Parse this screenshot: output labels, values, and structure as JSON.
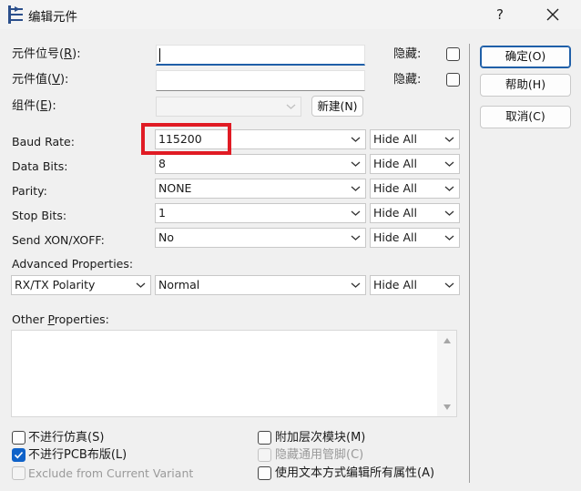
{
  "window": {
    "title": "编辑元件",
    "help_glyph": "?"
  },
  "fields": {
    "refdes": {
      "label": "元件位号(",
      "key": "R",
      "suffix": "):",
      "value": "",
      "hidden_label": "隐藏:"
    },
    "value": {
      "label": "元件值(",
      "key": "V",
      "suffix": "):",
      "value": "",
      "hidden_label": "隐藏:"
    },
    "group": {
      "label": "组件(",
      "key": "E",
      "suffix": "):",
      "value": "",
      "new_button": "新建(N)"
    }
  },
  "properties": [
    {
      "label": "Baud Rate:",
      "value": "115200",
      "visibility": "Hide All",
      "editable": true
    },
    {
      "label": "Data Bits:",
      "value": "8",
      "visibility": "Hide All"
    },
    {
      "label": "Parity:",
      "value": "NONE",
      "visibility": "Hide All"
    },
    {
      "label": "Stop Bits:",
      "value": "1",
      "visibility": "Hide All"
    },
    {
      "label": "Send XON/XOFF:",
      "value": "No",
      "visibility": "Hide All"
    }
  ],
  "advanced": {
    "label": "Advanced Properties:",
    "property": "RX/TX Polarity",
    "value": "Normal",
    "visibility": "Hide All"
  },
  "other": {
    "label_prefix": "Other ",
    "label_key": "P",
    "label_rest": "roperties:",
    "text": ""
  },
  "options": {
    "exclude_sim": {
      "label": "不进行仿真(S)",
      "checked": false
    },
    "exclude_pcb": {
      "label": "不进行PCB布版(L)",
      "checked": true
    },
    "exclude_variant": {
      "label": "Exclude from Current Variant",
      "checked": false,
      "disabled": true
    },
    "attach_hier": {
      "label": "附加层次模块(M)",
      "checked": false
    },
    "hide_pins": {
      "label": "隐藏通用管脚(C)",
      "checked": false,
      "disabled": true
    },
    "edit_text": {
      "label": "使用文本方式编辑所有属性(A)",
      "checked": false
    }
  },
  "buttons": {
    "ok": "确定(O)",
    "help": "帮助(H)",
    "cancel": "取消(C)"
  },
  "colors": {
    "accent": "#1f5fa8",
    "highlight": "#e01b24",
    "checkbox_checked": "#0f62c9"
  }
}
